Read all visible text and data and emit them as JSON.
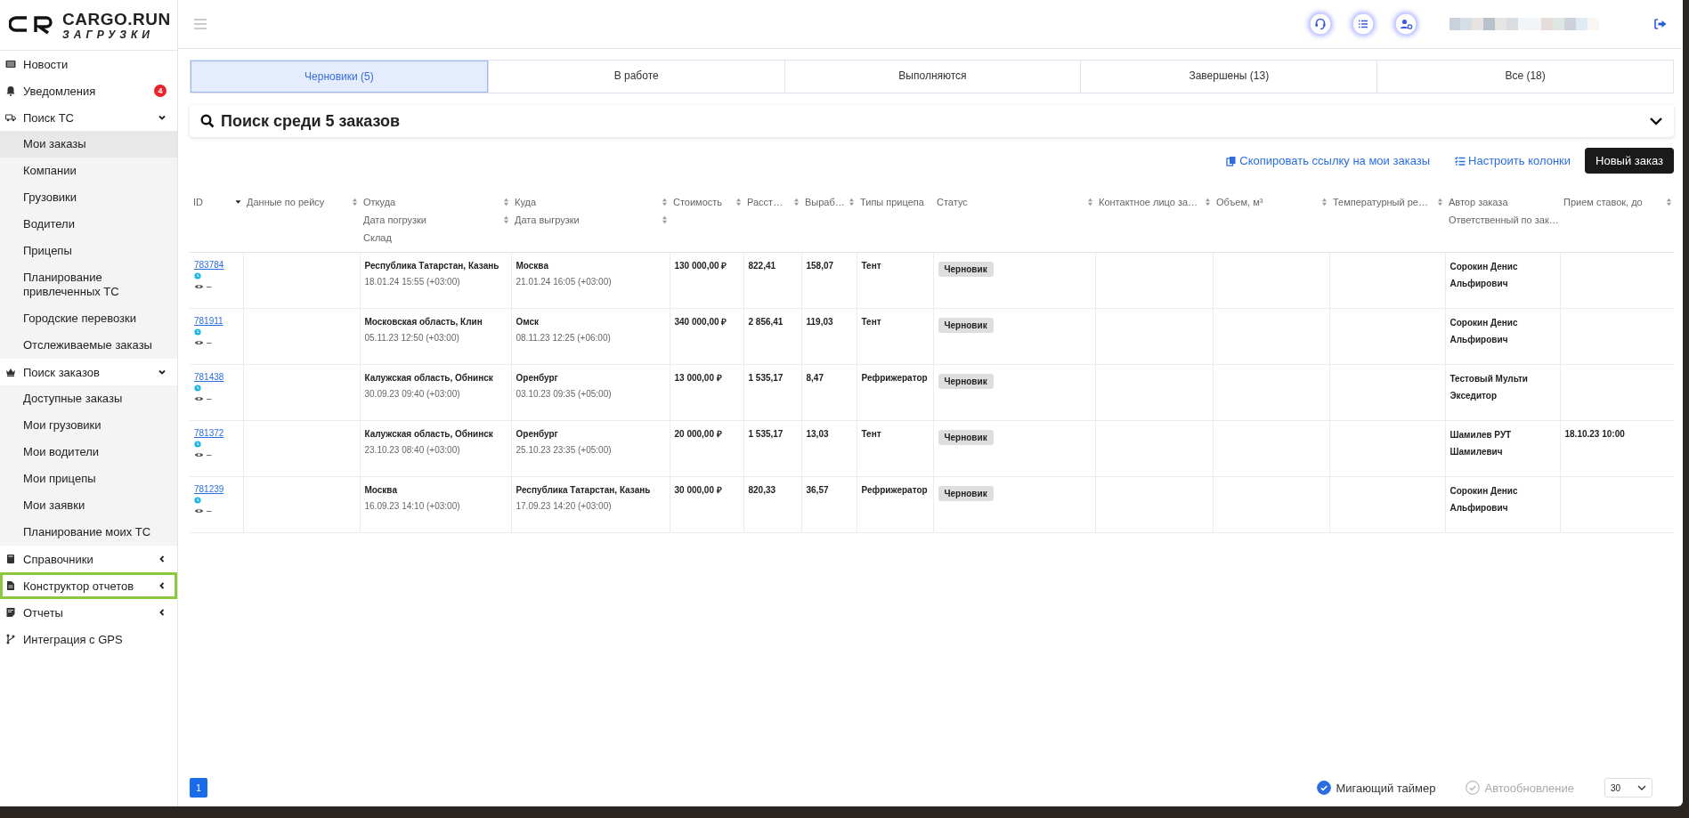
{
  "logo": {
    "name": "CARGO.RUN",
    "sub": "ЗАГРУЗКИ"
  },
  "sidebar": {
    "items": [
      {
        "label": "Новости"
      },
      {
        "label": "Уведомления",
        "badge": "4"
      },
      {
        "label": "Поиск ТС",
        "expanded": true,
        "children": [
          {
            "label": "Мои заказы",
            "selected": true
          },
          {
            "label": "Компании",
            "selected": false
          },
          {
            "label": "Грузовики",
            "selected": false
          },
          {
            "label": "Водители",
            "selected": false
          },
          {
            "label": "Прицепы",
            "selected": false
          },
          {
            "label": "Планирование привлеченных ТС",
            "selected": false
          },
          {
            "label": "Городские перевозки",
            "selected": false
          },
          {
            "label": "Отслеживаемые заказы",
            "selected": false
          }
        ]
      },
      {
        "label": "Поиск заказов",
        "expanded": true,
        "children": [
          {
            "label": "Доступные заказы",
            "selected": false
          },
          {
            "label": "Мои грузовики",
            "selected": false
          },
          {
            "label": "Мои водители",
            "selected": false
          },
          {
            "label": "Мои прицепы",
            "selected": false
          },
          {
            "label": "Мои заявки",
            "selected": false
          },
          {
            "label": "Планирование моих ТС",
            "selected": false
          }
        ]
      },
      {
        "label": "Справочники",
        "expanded": false
      },
      {
        "label": "Конструктор отчетов",
        "expanded": false,
        "highlighted": true
      },
      {
        "label": "Отчеты",
        "expanded": false
      },
      {
        "label": "Интеграция с GPS"
      }
    ]
  },
  "tabs": [
    {
      "label": "Черновики (5)",
      "selected": true
    },
    {
      "label": "В работе",
      "selected": false
    },
    {
      "label": "Выполняются",
      "selected": false
    },
    {
      "label": "Завершены (13)",
      "selected": false
    },
    {
      "label": "Все (18)",
      "selected": false
    }
  ],
  "search": {
    "title": "Поиск среди 5 заказов"
  },
  "actions": {
    "copy_link": "Скопировать ссылку на мои заказы",
    "columns": "Настроить колонки",
    "new_order": "Новый заказ"
  },
  "table": {
    "columns": [
      {
        "lines": [
          {
            "text": "ID",
            "sortable": true,
            "sorted": true
          }
        ]
      },
      {
        "lines": [
          {
            "text": "Данные по рейсу",
            "sortable": true,
            "sorted": false
          }
        ]
      },
      {
        "lines": [
          {
            "text": "Откуда",
            "sortable": true,
            "sorted": false
          },
          {
            "text": "Дата погрузки",
            "sortable": true,
            "sorted": false
          },
          {
            "text": "Склад",
            "sortable": false,
            "sorted": false
          }
        ]
      },
      {
        "lines": [
          {
            "text": "Куда",
            "sortable": true,
            "sorted": false
          },
          {
            "text": "Дата выгрузки",
            "sortable": true,
            "sorted": false
          }
        ]
      },
      {
        "lines": [
          {
            "text": "Стоимость",
            "sortable": true,
            "sorted": false
          }
        ]
      },
      {
        "lines": [
          {
            "text": "Расст…",
            "sortable": true,
            "sorted": false
          }
        ]
      },
      {
        "lines": [
          {
            "text": "Выраб…",
            "sortable": true,
            "sorted": false
          }
        ]
      },
      {
        "lines": [
          {
            "text": "Типы прицепа",
            "sortable": false,
            "sorted": false
          }
        ]
      },
      {
        "lines": [
          {
            "text": "Статус",
            "sortable": true,
            "sorted": false
          }
        ]
      },
      {
        "lines": [
          {
            "text": "Контактное лицо за…",
            "sortable": true,
            "sorted": false
          }
        ]
      },
      {
        "lines": [
          {
            "text": "Объем, м³",
            "sortable": true,
            "sorted": false
          }
        ]
      },
      {
        "lines": [
          {
            "text": "Температурный ре…",
            "sortable": true,
            "sorted": false
          }
        ]
      },
      {
        "lines": [
          {
            "text": "Автор заказа",
            "sortable": false,
            "sorted": false
          },
          {
            "text": "Ответственный по зак…",
            "sortable": false,
            "sorted": false
          }
        ]
      },
      {
        "lines": [
          {
            "text": "Прием ставок, до",
            "sortable": true,
            "sorted": false
          }
        ]
      }
    ],
    "rows": [
      {
        "id": "783784",
        "views": "–",
        "from": "Республика Татарстан, Казань",
        "from_date": "18.01.24 15:55 (+03:00)",
        "to": "Москва",
        "to_date": "21.01.24 16:05 (+03:00)",
        "cost": "130 000,00 ₽",
        "distance": "822,41",
        "output": "158,07",
        "trailer": "Тент",
        "status": "Черновик",
        "author": "Сорокин Денис Альфирович"
      },
      {
        "id": "781911",
        "views": "–",
        "from": "Московская область, Клин",
        "from_date": "05.11.23 12:50 (+03:00)",
        "to": "Омск",
        "to_date": "08.11.23 12:25 (+06:00)",
        "cost": "340 000,00 ₽",
        "distance": "2 856,41",
        "output": "119,03",
        "trailer": "Тент",
        "status": "Черновик",
        "author": "Сорокин Денис Альфирович"
      },
      {
        "id": "781438",
        "views": "–",
        "from": "Калужская область, Обнинск",
        "from_date": "30.09.23 09:40 (+03:00)",
        "to": "Оренбург",
        "to_date": "03.10.23 09:35 (+05:00)",
        "cost": "13 000,00 ₽",
        "distance": "1 535,17",
        "output": "8,47",
        "trailer": "Рефрижератор",
        "status": "Черновик",
        "author": "Тестовый Мульти Экседитор"
      },
      {
        "id": "781372",
        "views": "–",
        "from": "Калужская область, Обнинск",
        "from_date": "23.10.23 08:40 (+03:00)",
        "to": "Оренбург",
        "to_date": "25.10.23 23:35 (+05:00)",
        "cost": "20 000,00 ₽",
        "distance": "1 535,17",
        "output": "13,03",
        "trailer": "Тент",
        "status": "Черновик",
        "author": "Шамилев РУТ Шамилевич",
        "bid_deadline": "18.10.23 10:00"
      },
      {
        "id": "781239",
        "views": "–",
        "from": "Москва",
        "from_date": "16.09.23 14:10 (+03:00)",
        "to": "Республика Татарстан, Казань",
        "to_date": "17.09.23 14:20 (+03:00)",
        "cost": "30 000,00 ₽",
        "distance": "820,33",
        "output": "36,57",
        "trailer": "Рефрижератор",
        "status": "Черновик",
        "author": "Сорокин Денис Альфирович"
      }
    ]
  },
  "footer": {
    "pages": [
      {
        "label": "1",
        "selected": true
      }
    ],
    "toggles": [
      {
        "label": "Мигающий таймер",
        "checked": true
      },
      {
        "label": "Автообновление",
        "checked": false
      }
    ],
    "page_size": "30"
  }
}
